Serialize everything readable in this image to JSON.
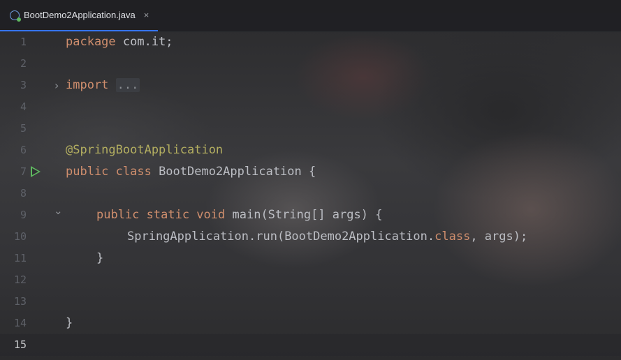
{
  "tab": {
    "filename": "BootDemo2Application.java",
    "close_glyph": "×",
    "icon": "java-class-icon"
  },
  "lines": [
    {
      "num": "1"
    },
    {
      "num": "2"
    },
    {
      "num": "3"
    },
    {
      "num": "4"
    },
    {
      "num": "5"
    },
    {
      "num": "6"
    },
    {
      "num": "7"
    },
    {
      "num": "8"
    },
    {
      "num": "9"
    },
    {
      "num": "10"
    },
    {
      "num": "11"
    },
    {
      "num": "12"
    },
    {
      "num": "13"
    },
    {
      "num": "14"
    },
    {
      "num": "15"
    }
  ],
  "code": {
    "l1_kw": "package",
    "l1_rest": " com.it;",
    "l3_kw": "import",
    "l3_folded": "...",
    "l6_ann": "@SpringBootApplication",
    "l7_kw": "public class",
    "l7_rest": " BootDemo2Application {",
    "l9_kw": "public static void",
    "l9_fn": "main",
    "l9_rest": "(String[] args) {",
    "l10_a": "SpringApplication.",
    "l10_fn": "run",
    "l10_b": "(BootDemo2Application.",
    "l10_kw": "class",
    "l10_c": ", args);",
    "l11": "}",
    "l14": "}"
  },
  "gutter": {
    "fold_closed": "›",
    "fold_open": "⌄",
    "run_icon": "run-gutter-icon"
  },
  "colors": {
    "keyword": "#cf8e6d",
    "annotation": "#b3ae60",
    "function": "#56a8f5",
    "text": "#bcbec4",
    "tab_accent": "#3574f0"
  }
}
